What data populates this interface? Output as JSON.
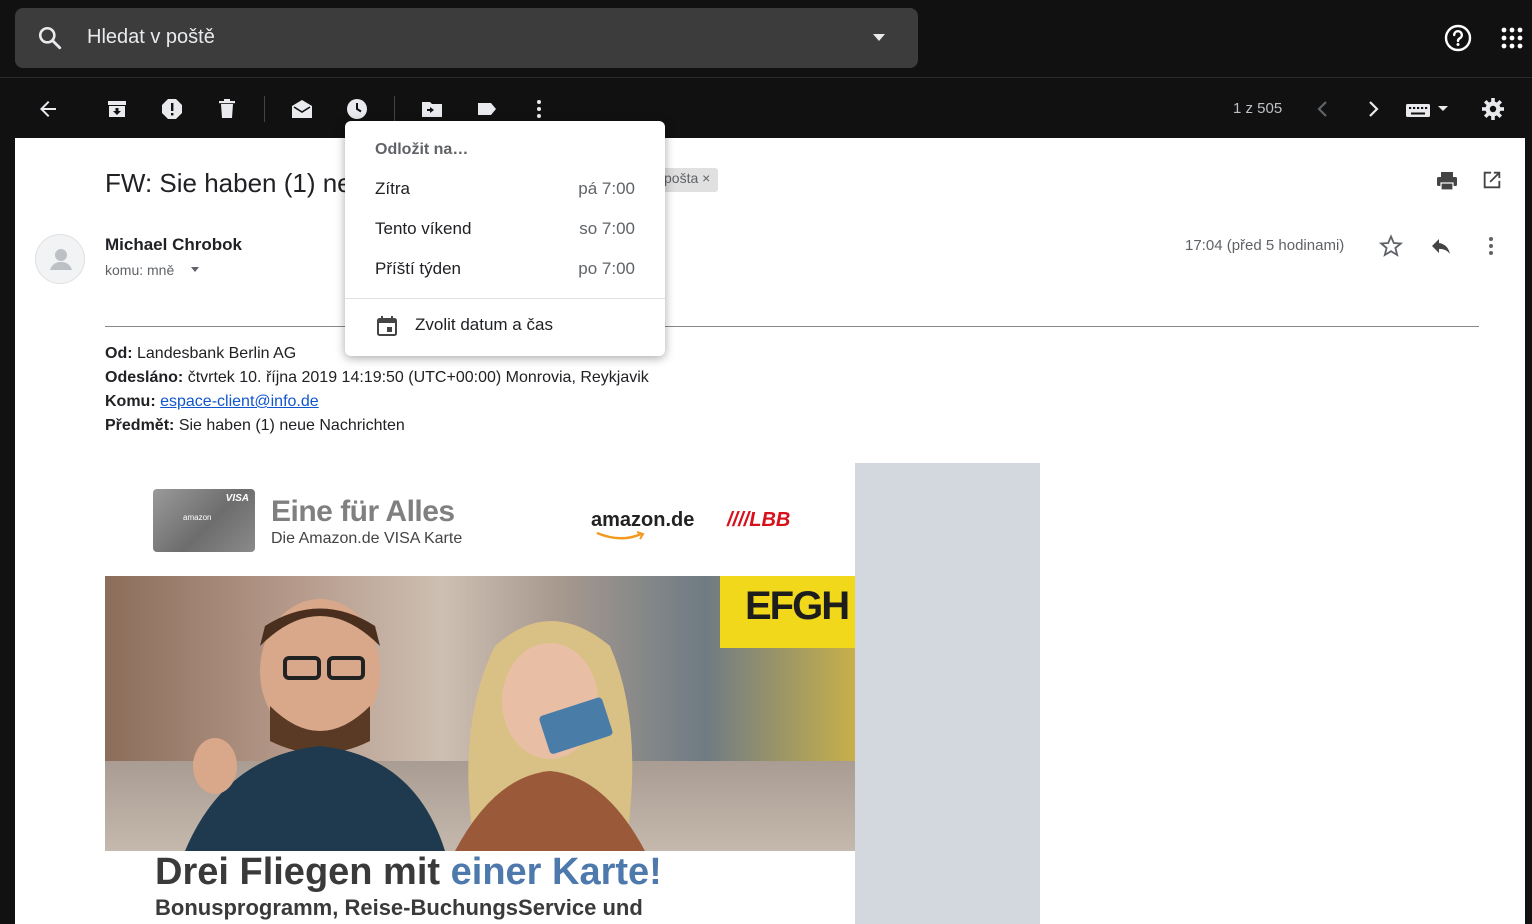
{
  "search": {
    "placeholder": "Hledat v poště"
  },
  "toolbar": {
    "pager": "1 z 505"
  },
  "message": {
    "subject": "FW: Sie haben (1) ne",
    "label_chip": "pošta ×",
    "sender": "Michael Chrobok",
    "to": "komu: mně",
    "date": "17:04 (před 5 hodinami)"
  },
  "forwarded": {
    "from_label": "Od:",
    "from_value": "Landesbank Berlin AG",
    "sent_label": "Odesláno:",
    "sent_value": "čtvrtek 10. října 2019 14:19:50 (UTC+00:00) Monrovia, Reykjavik",
    "to_label": "Komu:",
    "to_value": "espace-client@info.de",
    "subject_label": "Předmět:",
    "subject_value": "Sie haben (1) neue Nachrichten"
  },
  "promo": {
    "card_visa": "VISA",
    "card_amazon": "amazon",
    "title": "Eine für Alles",
    "subtitle": "Die Amazon.de VISA Karte",
    "amazon_logo": "amazon.de",
    "lbb_logo": "////LBB",
    "hero_sign": "EFGH",
    "headline_part1": "Drei Fliegen mit ",
    "headline_part2": "einer Karte!",
    "subhead": "Bonusprogramm, Reise-BuchungsService und"
  },
  "snooze": {
    "title": "Odložit na…",
    "options": [
      {
        "label": "Zítra",
        "time": "pá 7:00"
      },
      {
        "label": "Tento víkend",
        "time": "so 7:00"
      },
      {
        "label": "Příští týden",
        "time": "po 7:00"
      }
    ],
    "custom": "Zvolit datum a čas"
  },
  "colors": {
    "accent": "#4e79ac",
    "link": "#1155cc",
    "lbb_red": "#d8101c"
  }
}
